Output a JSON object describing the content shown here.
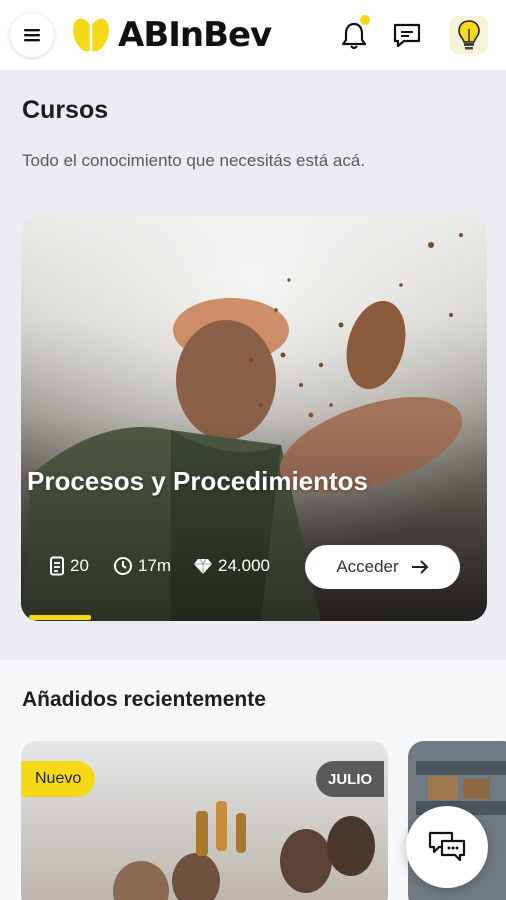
{
  "header": {
    "brand": "ABInBev",
    "icons": [
      "menu-icon",
      "bell-icon",
      "message-icon",
      "lightbulb-icon"
    ],
    "accent_color": "#f5d816"
  },
  "courses": {
    "title": "Cursos",
    "subtitle": "Todo el conocimiento que necesitás está acá."
  },
  "featured_course": {
    "title": "Procesos y Procedimientos",
    "lessons": "20",
    "duration": "17m",
    "points": "24.000",
    "button_label": "Acceder",
    "progress": 0.13
  },
  "recent": {
    "title": "Añadidos recientemente",
    "cards": [
      {
        "badge": "Nuevo",
        "month": "JULIO"
      }
    ]
  }
}
